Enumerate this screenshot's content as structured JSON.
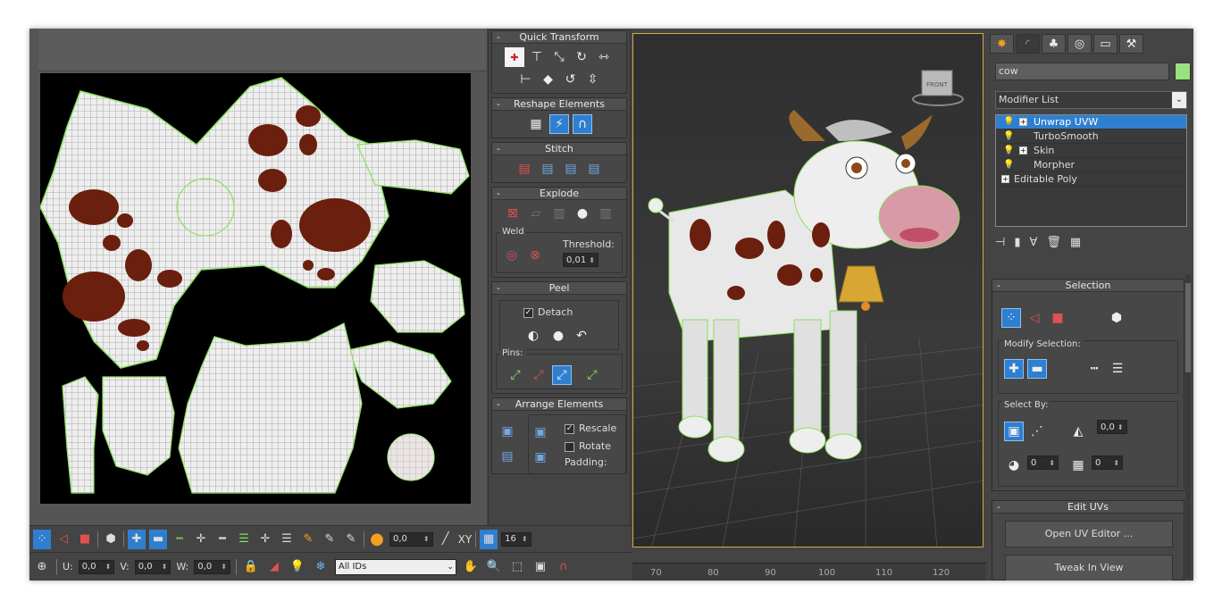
{
  "uv_editor": {
    "toolbar": {
      "value_field": "0,0",
      "axis_label": "XY",
      "grid_value": "16"
    },
    "coords": {
      "u_label": "U:",
      "u_value": "0,0",
      "v_label": "V:",
      "v_value": "0,0",
      "w_label": "W:",
      "w_value": "0,0",
      "id_filter": "All IDs"
    }
  },
  "tools_panel": {
    "quick_transform": "Quick Transform",
    "reshape_elements": "Reshape Elements",
    "stitch": "Stitch",
    "explode": "Explode",
    "weld": "Weld",
    "threshold_label": "Threshold:",
    "threshold_value": "0,01",
    "peel": "Peel",
    "detach_label": "Detach",
    "pins_label": "Pins:",
    "arrange_elements": "Arrange Elements",
    "rescale_label": "Rescale",
    "rotate_label": "Rotate",
    "padding_label": "Padding:"
  },
  "viewport": {
    "viewcube_label": "FRONT",
    "ruler_ticks": [
      "70",
      "80",
      "90",
      "100",
      "110",
      "120"
    ]
  },
  "command_panel": {
    "object_name": "cow",
    "modifier_list": "Modifier List",
    "stack": [
      {
        "label": "Unwrap UVW",
        "selected": true,
        "expandable": true
      },
      {
        "label": "TurboSmooth",
        "selected": false,
        "expandable": false
      },
      {
        "label": "Skin",
        "selected": false,
        "expandable": true
      },
      {
        "label": "Morpher",
        "selected": false,
        "expandable": false
      },
      {
        "label": "Editable Poly",
        "selected": false,
        "expandable": true
      }
    ],
    "selection": "Selection",
    "modify_selection": "Modify Selection:",
    "select_by": "Select By:",
    "angle_value": "0,0",
    "spinner_a": "0",
    "spinner_b": "0",
    "edit_uvs": "Edit UVs",
    "open_uv_editor": "Open UV Editor ...",
    "tweak_in_view": "Tweak In View"
  },
  "colors": {
    "accent": "#2f7fd0",
    "wire_green": "#8be05f",
    "viewport_border": "#d4a94a",
    "cow_spot": "#6b1f0e"
  }
}
